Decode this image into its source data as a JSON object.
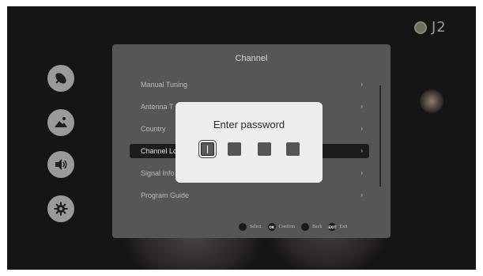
{
  "brand": {
    "logo_text": "J2"
  },
  "sidebar": {
    "items": [
      {
        "icon": "satellite-icon"
      },
      {
        "icon": "picture-icon"
      },
      {
        "icon": "sound-icon"
      },
      {
        "icon": "settings-gear-icon"
      }
    ]
  },
  "panel": {
    "title": "Channel",
    "items": [
      {
        "label": "Manual Tuning",
        "arrow": "›"
      },
      {
        "label": "Antenna T",
        "arrow": "›"
      },
      {
        "label": "Country",
        "arrow": "›"
      },
      {
        "label": "Channel Lo",
        "arrow": "›",
        "selected": true
      },
      {
        "label": "Signal Info",
        "arrow": "›"
      },
      {
        "label": "Program Guide",
        "arrow": "›"
      }
    ],
    "footer": [
      {
        "icon": "dpad-icon",
        "glyph": "",
        "label": "Select"
      },
      {
        "icon": "ok-icon",
        "glyph": "OK",
        "label": "Confirm"
      },
      {
        "icon": "back-icon",
        "glyph": "",
        "label": "Back"
      },
      {
        "icon": "exit-icon",
        "glyph": "EXIT",
        "label": "Exit"
      }
    ]
  },
  "dialog": {
    "title": "Enter password",
    "pin_digits": 4,
    "active_index": 0
  },
  "colors": {
    "panel": "#565656",
    "dialog": "#eeeeee",
    "selected_row": "#1c1c1c"
  }
}
